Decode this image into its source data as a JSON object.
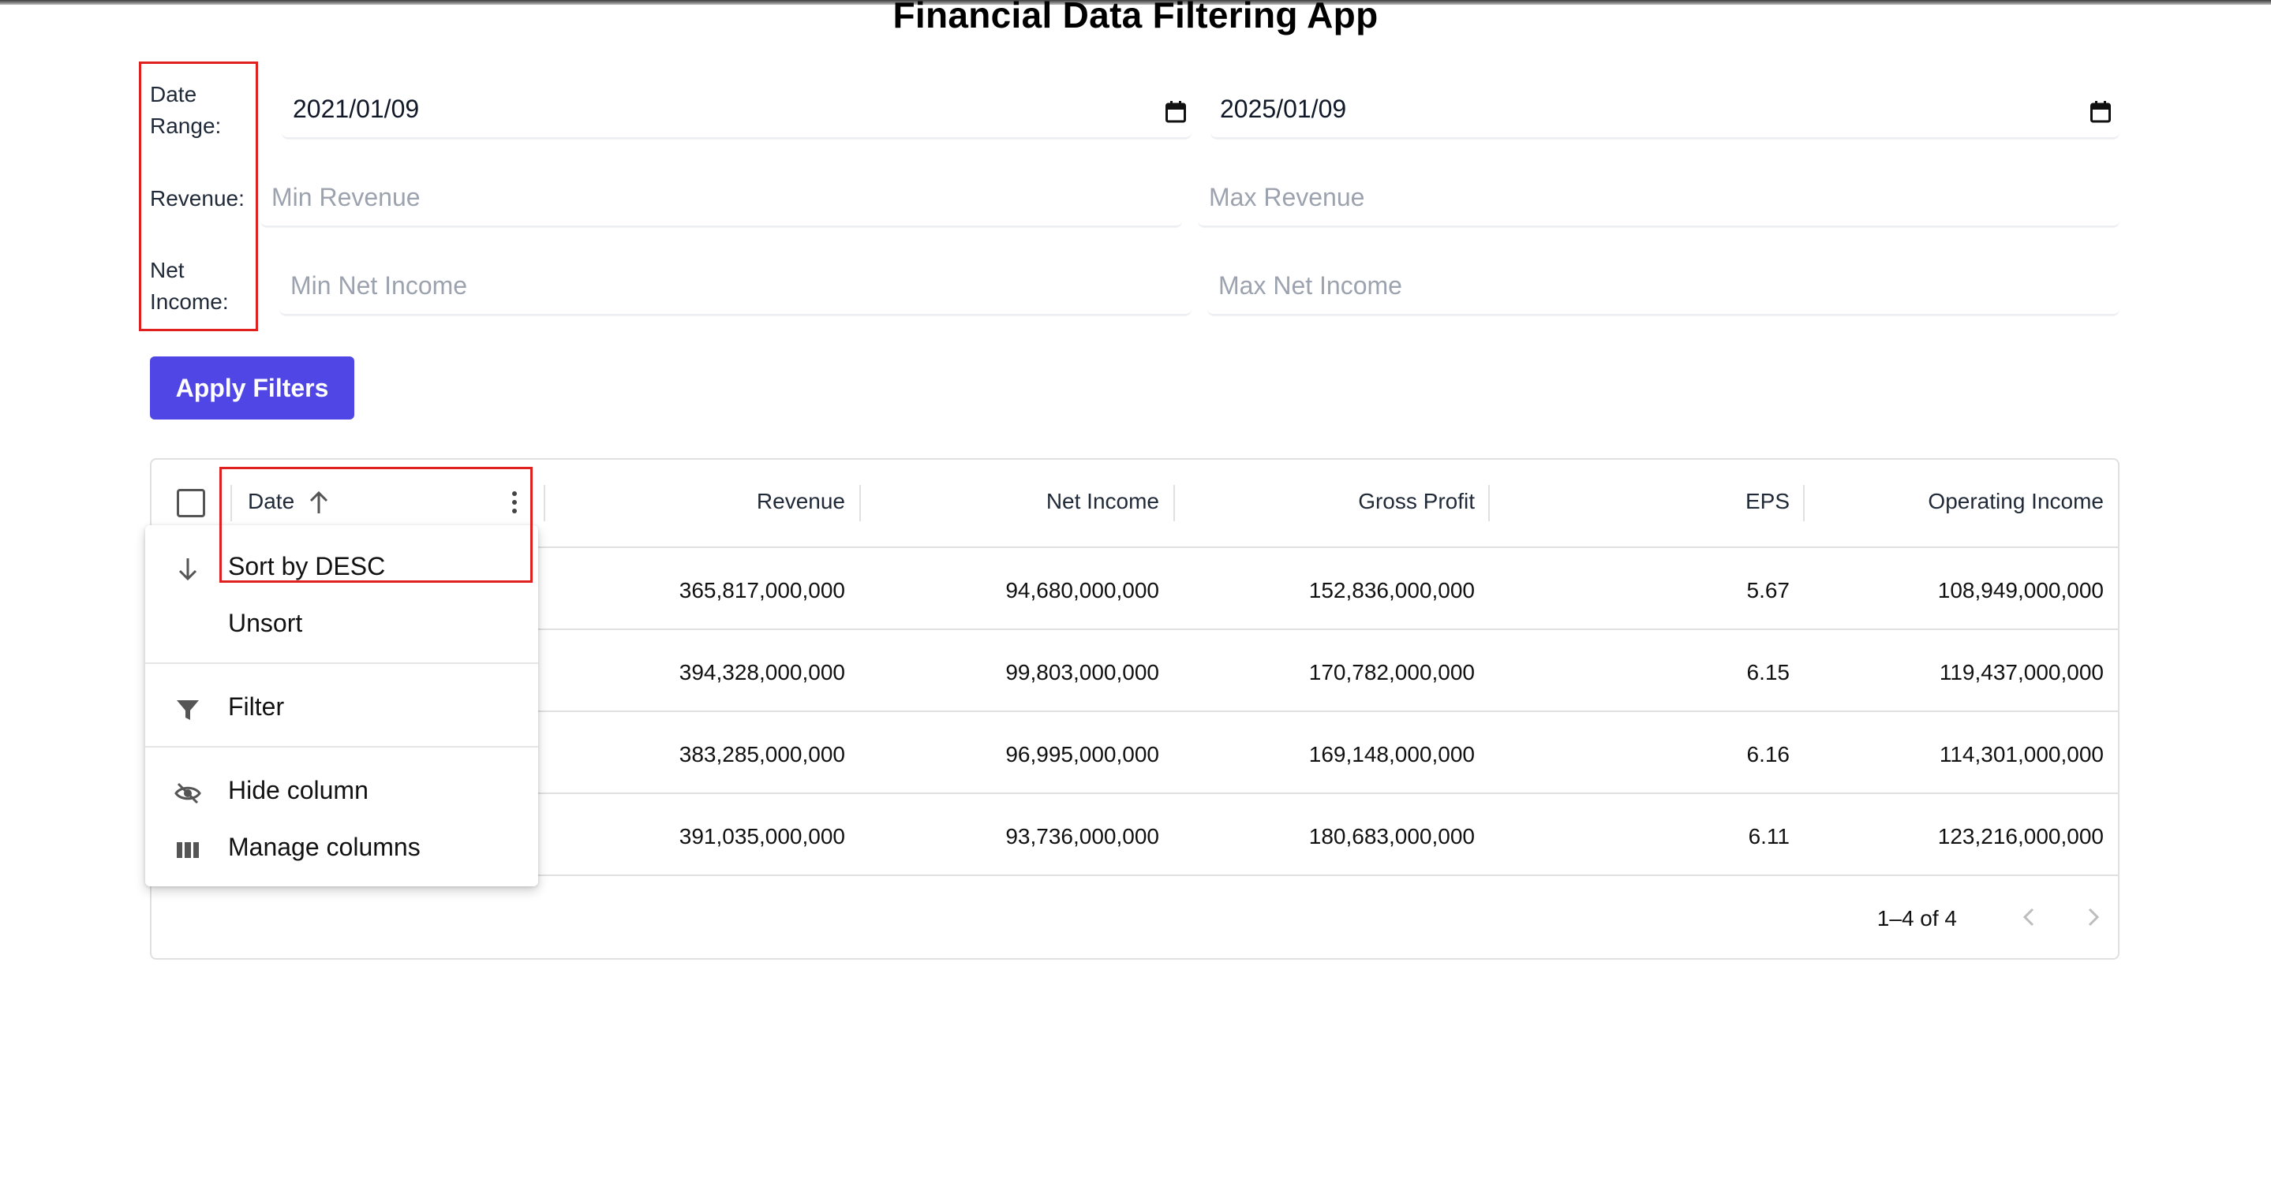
{
  "app": {
    "title": "Financial Data Filtering App"
  },
  "filters": {
    "date_label_1": "Date",
    "date_label_2": "Range:",
    "revenue_label": "Revenue:",
    "net_income_label_1": "Net",
    "net_income_label_2": "Income:",
    "date_start": "2021/01/09",
    "date_end": "2025/01/09",
    "min_revenue_placeholder": "Min Revenue",
    "max_revenue_placeholder": "Max Revenue",
    "min_net_income_placeholder": "Min Net Income",
    "max_net_income_placeholder": "Max Net Income",
    "apply_label": "Apply Filters"
  },
  "grid": {
    "columns": [
      "Date",
      "Revenue",
      "Net Income",
      "Gross Profit",
      "EPS",
      "Operating Income"
    ],
    "rows": [
      {
        "revenue": "365,817,000,000",
        "net_income": "94,680,000,000",
        "gross_profit": "152,836,000,000",
        "eps": "5.67",
        "operating_income": "108,949,000,000"
      },
      {
        "revenue": "394,328,000,000",
        "net_income": "99,803,000,000",
        "gross_profit": "170,782,000,000",
        "eps": "6.15",
        "operating_income": "119,437,000,000"
      },
      {
        "revenue": "383,285,000,000",
        "net_income": "96,995,000,000",
        "gross_profit": "169,148,000,000",
        "eps": "6.16",
        "operating_income": "114,301,000,000"
      },
      {
        "revenue": "391,035,000,000",
        "net_income": "93,736,000,000",
        "gross_profit": "180,683,000,000",
        "eps": "6.11",
        "operating_income": "123,216,000,000"
      }
    ],
    "pagination": "1–4 of 4",
    "sort_direction": "ascending"
  },
  "column_menu": {
    "sort_desc": "Sort by DESC",
    "unsort": "Unsort",
    "filter": "Filter",
    "hide_column": "Hide column",
    "manage_columns": "Manage columns"
  },
  "colors": {
    "accent": "#4f46e5",
    "highlight": "#e0201f"
  }
}
